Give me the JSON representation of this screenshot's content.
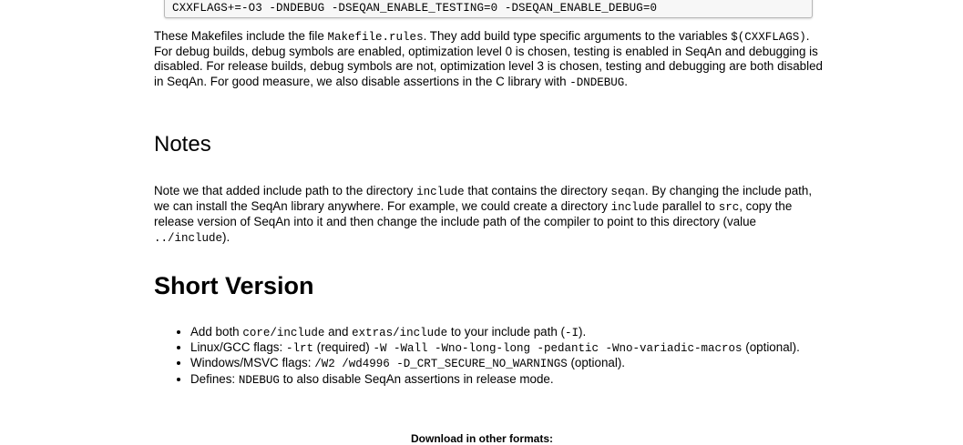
{
  "code_block": {
    "line": "CXXFLAGS+=-O3 -DNDEBUG -DSEQAN_ENABLE_TESTING=0 -DSEQAN_ENABLE_DEBUG=0"
  },
  "intro": {
    "t1": "These Makefiles include the file ",
    "c1": "Makefile.rules",
    "t2": ". They add build type specific arguments to the variables ",
    "c2": "$(CXXFLAGS)",
    "t3": ". For debug builds, debug symbols are enabled, optimization level 0 is chosen, testing is enabled in SeqAn and debugging is disabled. For release builds, debug symbols are not, optimization level 3 is chosen, testing and debugging are both disabled in SeqAn. For good measure, we also disable assertions in the C library with ",
    "c3": "-DNDEBUG",
    "t4": "."
  },
  "notes": {
    "heading": "Notes",
    "t1": "Note we that added include path to the directory ",
    "c1": "include",
    "t2": " that contains the directory ",
    "c2": "seqan",
    "t3": ". By changing the include path, we can install the SeqAn library anywhere. For example, we could create a directory ",
    "c3": "include",
    "t4": " parallel to ",
    "c4": "src",
    "t5": ", copy the release version of SeqAn into it and then change the include path of the compiler to point to this directory (value ",
    "c5": "../include",
    "t6": ")."
  },
  "short_version": {
    "heading": "Short Version",
    "b1": {
      "t1": "Add both ",
      "c1": "core/include",
      "t2": " and ",
      "c2": "extras/include",
      "t3": " to your include path (",
      "c3": "-I",
      "t4": ")."
    },
    "b2": {
      "t1": "Linux/GCC flags: ",
      "c1": "-lrt",
      "t2": " (required) ",
      "c2": "-W -Wall -Wno-long-long -pedantic -Wno-variadic-macros",
      "t3": " (optional)."
    },
    "b3": {
      "t1": "Windows/MSVC flags: ",
      "c1": "/W2 /wd4996 -D_CRT_SECURE_NO_WARNINGS",
      "t2": " (optional)."
    },
    "b4": {
      "t1": "Defines: ",
      "c1": "NDEBUG",
      "t2": " to also disable SeqAn assertions in release mode."
    }
  },
  "footer": {
    "download_label": "Download in other formats:"
  }
}
